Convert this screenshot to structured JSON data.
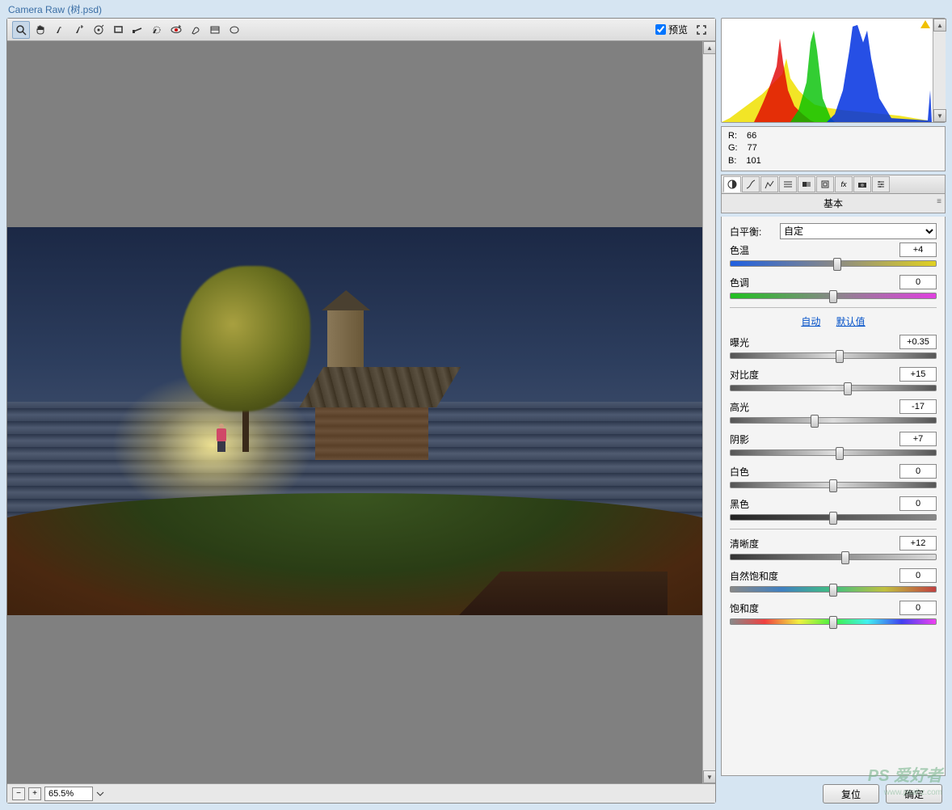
{
  "title": "Camera Raw (树.psd)",
  "preview_checkbox_label": "预览",
  "zoom": "65.5%",
  "rgb": {
    "r_label": "R:",
    "r": "66",
    "g_label": "G:",
    "g": "77",
    "b_label": "B:",
    "b": "101"
  },
  "panel_title": "基本",
  "white_balance": {
    "label": "白平衡:",
    "value": "自定"
  },
  "sliders": {
    "temperature": {
      "label": "色温",
      "value": "+4",
      "pos": 52
    },
    "tint": {
      "label": "色调",
      "value": "0",
      "pos": 50
    },
    "exposure": {
      "label": "曝光",
      "value": "+0.35",
      "pos": 53
    },
    "contrast": {
      "label": "对比度",
      "value": "+15",
      "pos": 57
    },
    "highlights": {
      "label": "高光",
      "value": "-17",
      "pos": 41
    },
    "shadows": {
      "label": "阴影",
      "value": "+7",
      "pos": 53
    },
    "whites": {
      "label": "白色",
      "value": "0",
      "pos": 50
    },
    "blacks": {
      "label": "黑色",
      "value": "0",
      "pos": 50
    },
    "clarity": {
      "label": "清晰度",
      "value": "+12",
      "pos": 56
    },
    "vibrance": {
      "label": "自然饱和度",
      "value": "0",
      "pos": 50
    },
    "saturation": {
      "label": "饱和度",
      "value": "0",
      "pos": 50
    }
  },
  "links": {
    "auto": "自动",
    "default": "默认值"
  },
  "buttons": {
    "reset": "复位",
    "ok": "确定"
  },
  "watermark": "PS 爱好者",
  "watermark_url": "www.psahz.com"
}
